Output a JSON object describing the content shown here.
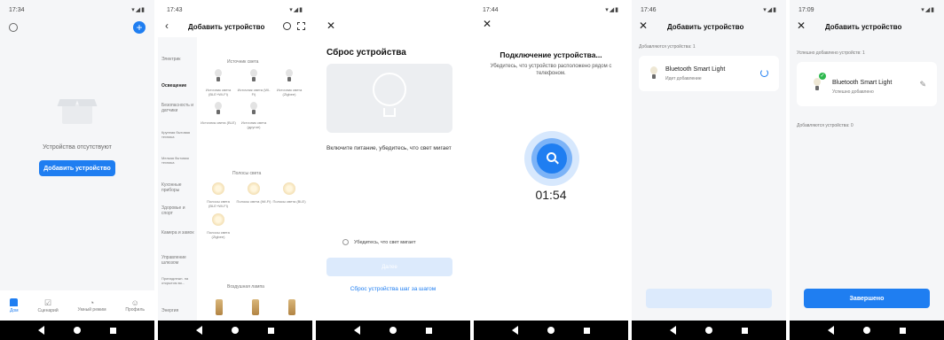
{
  "colors": {
    "accent": "#1f7ef1",
    "accent_disabled": "#dceafc",
    "bg": "#f5f6f8",
    "success": "#2db84d"
  },
  "screen1": {
    "time": "17:34",
    "empty_text": "Устройства отсутствуют",
    "add_button": "Добавить устройство",
    "tabs": [
      "Дом",
      "Сценарий",
      "Умный режим",
      "Профиль"
    ]
  },
  "screen2": {
    "time": "17:43",
    "title": "Добавить устройство",
    "categories": [
      "Электрик",
      "Освещение",
      "Безопасность и датчики",
      "Крупная бытовая техника",
      "Мелкая бытовая техника",
      "Кухонные приборы",
      "Здоровье и спорт",
      "Камера и замок",
      "Управление шлюзом",
      "Принадлежн. на открытом во...",
      "Энергия"
    ],
    "section1": "Источник света",
    "items1": [
      "Источник света (BLE+Wi-Fi)",
      "Источник света (Wi-Fi)",
      "Источник света (Zigbee)",
      "Источник света (BLE)",
      "Источник света (другое)"
    ],
    "section2": "Полосы света",
    "items2": [
      "Полосы света (BLE+Wi-Fi)",
      "Полосы света (Wi-Fi)",
      "Полосы света (BLE)",
      "Полосы света (Zigbee)"
    ],
    "section3": "Воздушная лампа"
  },
  "screen3": {
    "title": "Сброс устройства",
    "instruction": "Включите питание, убедитесь, что свет мигает",
    "confirm": "Убедитесь, что свет мигает",
    "next": "Далее",
    "link": "Сброс устройства шаг за шагом"
  },
  "screen4": {
    "time": "17:44",
    "title": "Подключение устройства...",
    "subtitle": "Убедитесь, что устройство расположено рядом с телефоном.",
    "timer": "01:54"
  },
  "screen5": {
    "time": "17:46",
    "title": "Добавить устройство",
    "adding": "Добавляются устройства: 1",
    "device": "Bluetooth Smart Light",
    "status": "Идет добавление"
  },
  "screen6": {
    "time": "17:09",
    "title": "Добавить устройство",
    "success_header": "Успешно добавлено устройств: 1",
    "device": "Bluetooth Smart Light",
    "status": "Успешно добавлено",
    "adding": "Добавляются устройства: 0",
    "done": "Завершено"
  }
}
